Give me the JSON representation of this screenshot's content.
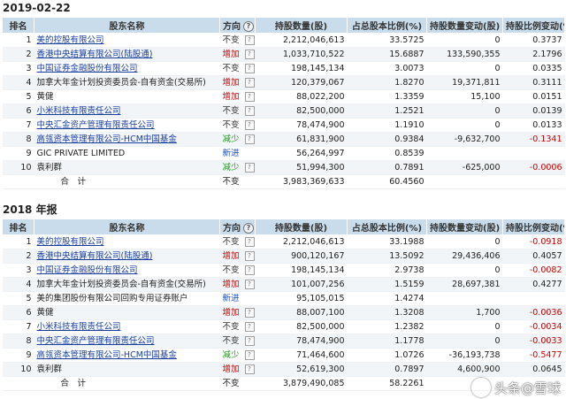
{
  "headers": {
    "rank": "排名",
    "name": "股东名称",
    "direction": "方向",
    "shares": "持股数量(股)",
    "pct": "占总股本比例(%)",
    "change": "持股数量变动(股)",
    "pct_change": "持股比例变动(%)"
  },
  "sections": [
    {
      "title": "2019-02-22",
      "rows": [
        {
          "rank": "1",
          "name": "美的控股有限公司",
          "link": true,
          "dir": "不变",
          "dir_type": "flat",
          "q": true,
          "shares": "2,212,046,613",
          "pct": "33.5725",
          "change": "0",
          "pct_change": "0.3737",
          "neg": false
        },
        {
          "rank": "2",
          "name": "香港中央结算有限公司(陆股通)",
          "link": true,
          "dir": "增加",
          "dir_type": "up",
          "q": true,
          "shares": "1,033,710,522",
          "pct": "15.6887",
          "change": "133,590,355",
          "pct_change": "2.1796",
          "neg": false
        },
        {
          "rank": "3",
          "name": "中国证券金融股份有限公司",
          "link": true,
          "dir": "不变",
          "dir_type": "flat",
          "q": true,
          "shares": "198,145,134",
          "pct": "3.0073",
          "change": "0",
          "pct_change": "0.0335",
          "neg": false
        },
        {
          "rank": "4",
          "name": "加拿大年金计划投资委员会-自有资金(交易所)",
          "link": false,
          "dir": "增加",
          "dir_type": "up",
          "q": true,
          "shares": "120,379,067",
          "pct": "1.8270",
          "change": "19,371,811",
          "pct_change": "0.3111",
          "neg": false
        },
        {
          "rank": "5",
          "name": "黄健",
          "link": false,
          "dir": "增加",
          "dir_type": "up",
          "q": true,
          "shares": "88,022,200",
          "pct": "1.3359",
          "change": "15,100",
          "pct_change": "0.0151",
          "neg": false
        },
        {
          "rank": "6",
          "name": "小米科技有限责任公司",
          "link": true,
          "dir": "不变",
          "dir_type": "flat",
          "q": true,
          "shares": "82,500,000",
          "pct": "1.2521",
          "change": "0",
          "pct_change": "0.0139",
          "neg": false
        },
        {
          "rank": "7",
          "name": "中央汇金资产管理有限责任公司",
          "link": true,
          "dir": "不变",
          "dir_type": "flat",
          "q": true,
          "shares": "78,474,900",
          "pct": "1.1910",
          "change": "0",
          "pct_change": "0.0133",
          "neg": false
        },
        {
          "rank": "8",
          "name": "高瓴资本管理有限公司-HCM中国基金",
          "link": true,
          "dir": "减少",
          "dir_type": "down",
          "q": true,
          "shares": "61,831,900",
          "pct": "0.9384",
          "change": "-9,632,700",
          "pct_change": "-0.1341",
          "neg": true
        },
        {
          "rank": "9",
          "name": "GIC PRIVATE LIMITED",
          "link": false,
          "dir": "新进",
          "dir_type": "new",
          "q": false,
          "shares": "56,264,997",
          "pct": "0.8539",
          "change": "",
          "pct_change": "",
          "neg": false
        },
        {
          "rank": "10",
          "name": "袁利群",
          "link": false,
          "dir": "减少",
          "dir_type": "down",
          "q": true,
          "shares": "51,994,300",
          "pct": "0.7891",
          "change": "-625,000",
          "pct_change": "-0.0006",
          "neg": true
        }
      ],
      "total": {
        "label": "合　计",
        "dir": "不变",
        "shares": "3,983,369,633",
        "pct": "60.4560"
      }
    },
    {
      "title": "2018 年报",
      "rows": [
        {
          "rank": "1",
          "name": "美的控股有限公司",
          "link": true,
          "dir": "不变",
          "dir_type": "flat",
          "q": true,
          "shares": "2,212,046,613",
          "pct": "33.1988",
          "change": "0",
          "pct_change": "-0.0918",
          "neg": true
        },
        {
          "rank": "2",
          "name": "香港中央结算有限公司(陆股通)",
          "link": true,
          "dir": "增加",
          "dir_type": "up",
          "q": true,
          "shares": "900,120,167",
          "pct": "13.5092",
          "change": "29,436,406",
          "pct_change": "0.4057",
          "neg": false
        },
        {
          "rank": "3",
          "name": "中国证券金融股份有限公司",
          "link": true,
          "dir": "不变",
          "dir_type": "flat",
          "q": true,
          "shares": "198,145,134",
          "pct": "2.9738",
          "change": "0",
          "pct_change": "-0.0082",
          "neg": true
        },
        {
          "rank": "4",
          "name": "加拿大年金计划投资委员会-自有资金(交易所)",
          "link": false,
          "dir": "增加",
          "dir_type": "up",
          "q": true,
          "shares": "101,007,256",
          "pct": "1.5159",
          "change": "28,697,381",
          "pct_change": "0.4277",
          "neg": false
        },
        {
          "rank": "5",
          "name": "美的集团股份有限公司回购专用证券账户",
          "link": false,
          "dir": "新进",
          "dir_type": "new",
          "q": false,
          "shares": "95,105,015",
          "pct": "1.4274",
          "change": "",
          "pct_change": "",
          "neg": false
        },
        {
          "rank": "6",
          "name": "黄健",
          "link": false,
          "dir": "增加",
          "dir_type": "up",
          "q": true,
          "shares": "88,007,100",
          "pct": "1.3208",
          "change": "1,700",
          "pct_change": "-0.0036",
          "neg": true
        },
        {
          "rank": "7",
          "name": "小米科技有限责任公司",
          "link": true,
          "dir": "不变",
          "dir_type": "flat",
          "q": true,
          "shares": "82,500,000",
          "pct": "1.2382",
          "change": "0",
          "pct_change": "-0.0034",
          "neg": true
        },
        {
          "rank": "8",
          "name": "中央汇金资产管理有限责任公司",
          "link": true,
          "dir": "不变",
          "dir_type": "flat",
          "q": true,
          "shares": "78,474,900",
          "pct": "1.1778",
          "change": "0",
          "pct_change": "-0.0033",
          "neg": true
        },
        {
          "rank": "9",
          "name": "高瓴资本管理有限公司-HCM中国基金",
          "link": true,
          "dir": "减少",
          "dir_type": "down",
          "q": true,
          "shares": "71,464,600",
          "pct": "1.0726",
          "change": "-36,193,738",
          "pct_change": "-0.5477",
          "neg": true
        },
        {
          "rank": "10",
          "name": "袁利群",
          "link": false,
          "dir": "增加",
          "dir_type": "up",
          "q": true,
          "shares": "52,619,300",
          "pct": "0.7897",
          "change": "4,600,900",
          "pct_change": "0.0645",
          "neg": false
        }
      ],
      "total": {
        "label": "合　计",
        "dir": "不变",
        "shares": "3,879,490,085",
        "pct": "58.2261"
      }
    }
  ],
  "watermark": {
    "text": "头条@雪球"
  }
}
